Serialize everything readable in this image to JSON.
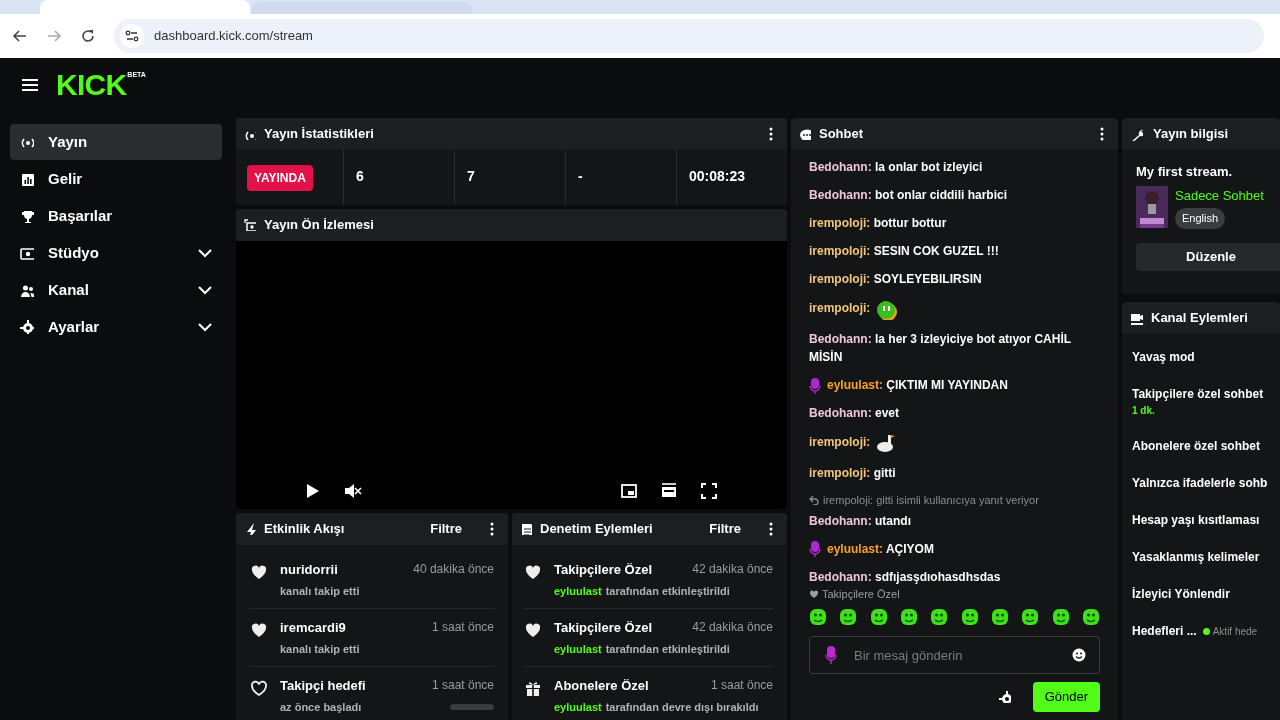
{
  "browser": {
    "url": "dashboard.kick.com/stream"
  },
  "header": {
    "logo": "KICK",
    "logo_badge": "BETA"
  },
  "sidebar": {
    "items": [
      {
        "label": "Yayın",
        "selected": true,
        "has_submenu": false
      },
      {
        "label": "Gelir",
        "selected": false,
        "has_submenu": false
      },
      {
        "label": "Başarılar",
        "selected": false,
        "has_submenu": false
      },
      {
        "label": "Stüdyo",
        "selected": false,
        "has_submenu": true
      },
      {
        "label": "Kanal",
        "selected": false,
        "has_submenu": true
      },
      {
        "label": "Ayarlar",
        "selected": false,
        "has_submenu": true
      }
    ]
  },
  "stats": {
    "title": "Yayın İstatistikleri",
    "live_badge": "YAYINDA",
    "values": [
      "6",
      "7",
      "-",
      "00:08:23"
    ]
  },
  "preview": {
    "title": "Yayın Ön İzlemesi"
  },
  "activity": {
    "title": "Etkinlik Akışı",
    "filter": "Filtre",
    "items": [
      {
        "kind": "follow",
        "name": "nuridorrii",
        "time": "40 dakika önce",
        "detail": "kanalı takip etti"
      },
      {
        "kind": "follow",
        "name": "iremcardi9",
        "time": "1 saat önce",
        "detail": "kanalı takip etti"
      },
      {
        "kind": "goal",
        "name": "Takipçi hedefi",
        "time": "1 saat önce",
        "detail": "az önce başladı",
        "level": 0
      }
    ]
  },
  "moderation": {
    "title": "Denetim Eylemleri",
    "filter": "Filtre",
    "items": [
      {
        "kind": "follower",
        "title": "Takipçilere Özel",
        "time": "42 dakika önce",
        "actor": "eyluulast",
        "action": "tarafından etkinleştirildi"
      },
      {
        "kind": "follower",
        "title": "Takipçilere Özel",
        "time": "42 dakika önce",
        "actor": "eyluulast",
        "action": "tarafından etkinleştirildi"
      },
      {
        "kind": "subscriber",
        "title": "Abonelere Özel",
        "time": "1 saat önce",
        "actor": "eyluulast",
        "action": "tarafından devre dışı bırakıldı"
      }
    ]
  },
  "chat": {
    "title": "Sohbet",
    "messages": [
      {
        "kind": "text",
        "user": "Bedohann:",
        "color": "#f0c6dd",
        "text": "la onlar bot izleyici"
      },
      {
        "kind": "text",
        "user": "Bedohann:",
        "color": "#f0c6dd",
        "text": "bot onlar ciddili harbici"
      },
      {
        "kind": "text",
        "user": "irempoloji:",
        "color": "#f3c77c",
        "text": "bottur bottur"
      },
      {
        "kind": "text",
        "user": "irempoloji:",
        "color": "#f3c77c",
        "text": "SESIN COK GUZEL !!!"
      },
      {
        "kind": "text",
        "user": "irempoloji:",
        "color": "#f3c77c",
        "text": "SOYLEYEBILIRSIN"
      },
      {
        "kind": "emote",
        "user": "irempoloji:",
        "color": "#f3c77c"
      },
      {
        "kind": "text",
        "user": "Bedohann:",
        "color": "#f0c6dd",
        "text": "la her 3 izleyiciye bot atıyor CAHİL MİSİN"
      },
      {
        "kind": "text",
        "user": "eyluulast:",
        "color": "#f7a12a",
        "text": "ÇIKTIM MI YAYINDAN",
        "has_badge": true
      },
      {
        "kind": "text",
        "user": "Bedohann:",
        "color": "#f0c6dd",
        "text": "evet"
      },
      {
        "kind": "emote",
        "user": "irempoloji:",
        "color": "#f3c77c"
      },
      {
        "kind": "text",
        "user": "irempoloji:",
        "color": "#f3c77c",
        "text": "gitti"
      },
      {
        "kind": "text",
        "user": "Bedohann:",
        "color": "#f0c6dd",
        "text": "utandı",
        "reply": "irempoloji: gitti isimli kullanıcıya yanıt veriyor"
      },
      {
        "kind": "text",
        "user": "eyluulast:",
        "color": "#f7a12a",
        "text": "AÇIYOM",
        "has_badge": true
      },
      {
        "kind": "text",
        "user": "Bedohann:",
        "color": "#f0c6dd",
        "text": "sdfıjasşdıohasdhsdas"
      }
    ],
    "emote_label": "Takipçilere Özel",
    "placeholder": "Bir mesaj gönderin",
    "send": "Gönder"
  },
  "stream_info": {
    "title": "Yayın bilgisi",
    "stream_title": "My first stream.",
    "category": "Sadece Sohbet",
    "language": "English",
    "edit": "Düzenle"
  },
  "channel_actions": {
    "title": "Kanal Eylemleri",
    "items": [
      {
        "label": "Yavaş mod"
      },
      {
        "label": "Takipçilere özel sohbet",
        "sub": "1 dk."
      },
      {
        "label": "Abonelere özel sohbet"
      },
      {
        "label": "Yalnızca ifadelerle sohb"
      },
      {
        "label": "Hesap yaşı kısıtlaması"
      },
      {
        "label": "Yasaklanmış kelimeler"
      },
      {
        "label": "İzleyici Yönlendir"
      },
      {
        "label": "Hedefleri ...",
        "status": "Aktif hede",
        "color": "#53fc18"
      }
    ]
  }
}
